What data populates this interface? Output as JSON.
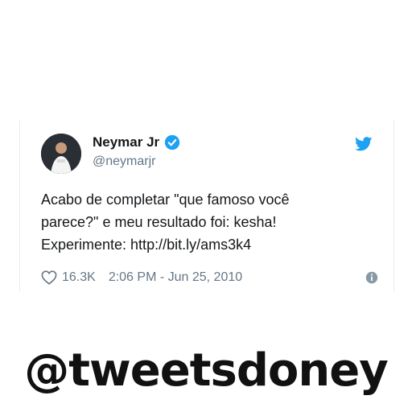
{
  "tweet": {
    "display_name": "Neymar Jr",
    "handle": "@neymarjr",
    "text_lines": [
      "Acabo de completar \"que famoso você",
      "parece?\" e meu resultado foi: kesha!",
      "Experimente: http://bit.ly/ams3k4"
    ],
    "likes": "16.3K",
    "timestamp": "2:06 PM - Jun 25, 2010",
    "verified": true
  },
  "icons": {
    "verified": "verified-badge-icon",
    "brand": "twitter-bird-icon",
    "like": "heart-outline-icon",
    "info": "info-icon"
  },
  "colors": {
    "brand_blue": "#1da1f2",
    "text_primary": "#14171a",
    "text_secondary": "#657786"
  },
  "watermark": "@tweetsdoney"
}
